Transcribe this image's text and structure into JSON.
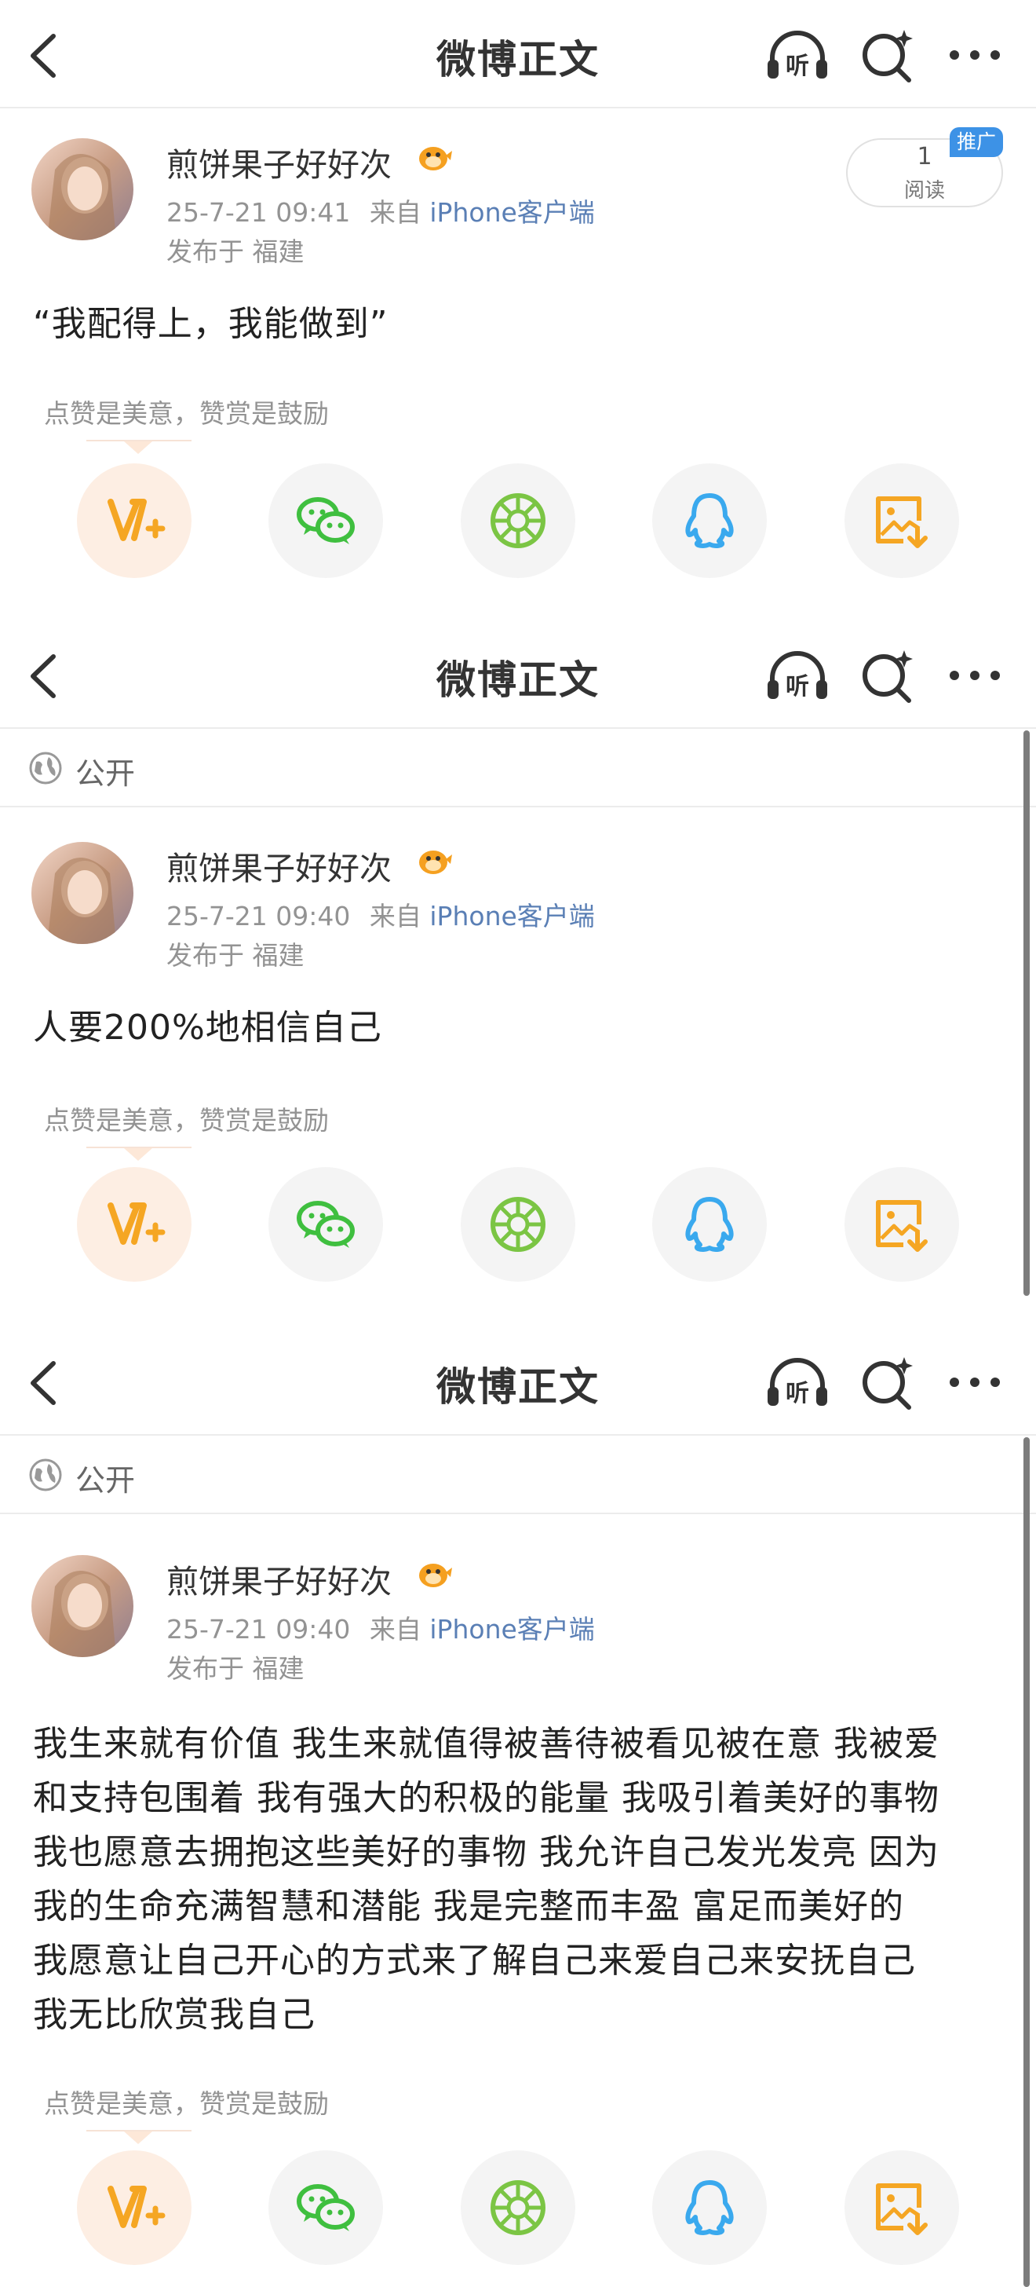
{
  "screens": [
    {
      "header": {
        "title": "微博正文"
      },
      "post": {
        "username": "煎饼果子好好次",
        "timestamp": "25-7-21 09:41",
        "source_prefix": "来自",
        "source": "iPhone客户端",
        "location": "发布于 福建",
        "content": "“我配得上，我能做到”",
        "read_count": "1",
        "read_label": "阅读",
        "promo_label": "推广"
      },
      "tip": "点赞是美意，赞赏是鼓励"
    },
    {
      "header": {
        "title": "微博正文"
      },
      "visibility": "公开",
      "post": {
        "username": "煎饼果子好好次",
        "timestamp": "25-7-21 09:40",
        "source_prefix": "来自",
        "source": "iPhone客户端",
        "location": "发布于 福建",
        "content": "人要200%地相信自己"
      },
      "tip": "点赞是美意，赞赏是鼓励"
    },
    {
      "header": {
        "title": "微博正文"
      },
      "visibility": "公开",
      "post": {
        "username": "煎饼果子好好次",
        "timestamp": "25-7-21 09:40",
        "source_prefix": "来自",
        "source": "iPhone客户端",
        "location": "发布于 福建",
        "content_lines": [
          "我生来就有价值 我生来就值得被善待被看见被在意 我被爱",
          "和支持包围着 我有强大的积极的能量 我吸引着美好的事物",
          "我也愿意去拥抱这些美好的事物  我允许自己发光发亮 因为",
          "我的生命充满智慧和潜能  我是完整而丰盈 富足而美好的",
          "我愿意让自己开心的方式来了解自己来爱自己来安抚自己",
          "我无比欣赏我自己"
        ]
      },
      "tip": "点赞是美意，赞赏是鼓励"
    }
  ],
  "icons": {
    "back": "back-arrow-icon",
    "listen": "listen-headphones-icon",
    "search": "search-sparkle-icon",
    "more": "more-dots-icon",
    "globe": "globe-icon",
    "share": [
      "weibo-reward-icon",
      "wechat-icon",
      "moments-icon",
      "qq-icon",
      "save-image-icon"
    ]
  },
  "colors": {
    "link": "#5a7fb5",
    "muted": "#939393",
    "reward_bg": "#fdeee3",
    "reward_icon": "#f5a623",
    "wechat": "#3fbf3f",
    "moments": "#7bc544",
    "qq": "#3aa9ee",
    "save": "#f5a623",
    "promo": "#3d92e6"
  }
}
